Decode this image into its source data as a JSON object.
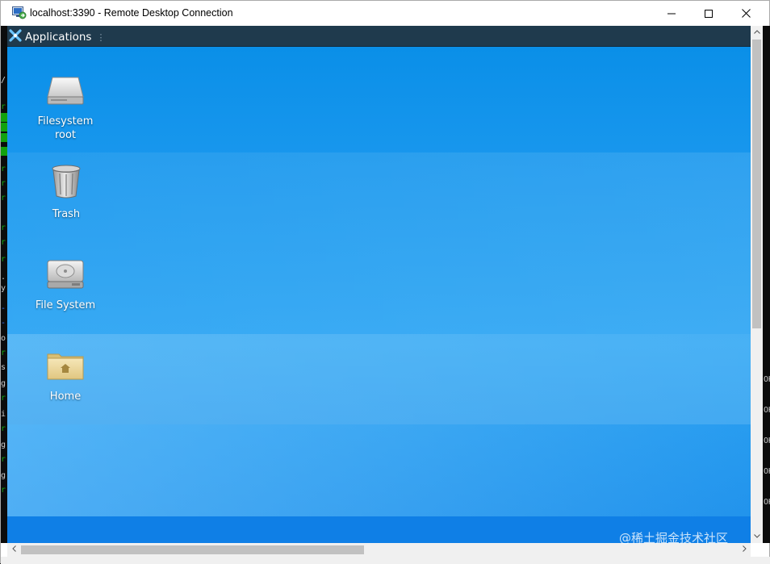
{
  "window": {
    "title": "localhost:3390 - Remote Desktop Connection",
    "icons": {
      "app": "remote-desktop-icon",
      "minimize": "minimize-icon",
      "maximize": "maximize-icon",
      "close": "close-icon"
    }
  },
  "panel": {
    "applications_label": "Applications",
    "separator": "⋮",
    "logo_icon": "xfce-logo-icon"
  },
  "desktop": {
    "icons": [
      {
        "label": "Filesystem\nroot",
        "icon": "drive-icon"
      },
      {
        "label": "Trash",
        "icon": "trash-icon"
      },
      {
        "label": "File System",
        "icon": "hard-disk-icon"
      },
      {
        "label": "Home",
        "icon": "home-folder-icon"
      }
    ]
  },
  "host_terminal": {
    "right_fragments": [
      "OK",
      "OK",
      "OK",
      "OK",
      "OK"
    ]
  },
  "watermark": "@稀土掘金技术社区",
  "colors": {
    "panel": "#1f3a4d",
    "desktop_top": "#0a8fe8",
    "desktop_mid": "#2aa4f3",
    "terminal_bg": "#0c0c0c",
    "terminal_green": "#13a10e"
  }
}
